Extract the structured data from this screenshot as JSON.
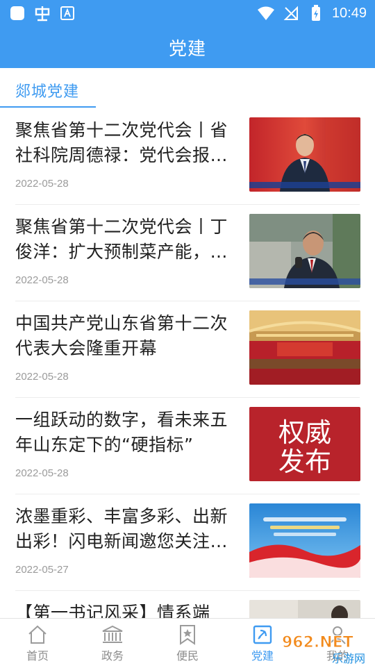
{
  "status_bar": {
    "time": "10:49"
  },
  "header": {
    "title": "党建"
  },
  "section": {
    "title": "郯城党建"
  },
  "articles": [
    {
      "title": "聚焦省第十二次党代会丨省社科院周德禄：党代会报…",
      "date": "2022-05-28"
    },
    {
      "title": "聚焦省第十二次党代会丨丁俊洋：扩大预制菜产能，…",
      "date": "2022-05-28"
    },
    {
      "title": "中国共产党山东省第十二次代表大会隆重开幕",
      "date": "2022-05-28"
    },
    {
      "title": "一组跃动的数字，看未来五年山东定下的“硬指标”",
      "date": "2022-05-28",
      "thumb_text": [
        "权威",
        "发布"
      ]
    },
    {
      "title": "浓墨重彩、丰富多彩、出新出彩！闪电新闻邀您关注…",
      "date": "2022-05-27"
    },
    {
      "title": "【第一书记风采】情系端",
      "date": ""
    }
  ],
  "tabs": [
    {
      "label": "首页",
      "icon": "home-icon"
    },
    {
      "label": "政务",
      "icon": "government-building-icon"
    },
    {
      "label": "便民",
      "icon": "bookmark-star-icon"
    },
    {
      "label": "党建",
      "icon": "party-emblem-icon",
      "active": true
    },
    {
      "label": "我的",
      "icon": "user-icon"
    }
  ],
  "watermark": {
    "text_main": "962.NET",
    "text_sub": "乐游网"
  },
  "colors": {
    "accent": "#3f9bf1",
    "text": "#222222",
    "muted": "#9b9b9b"
  }
}
